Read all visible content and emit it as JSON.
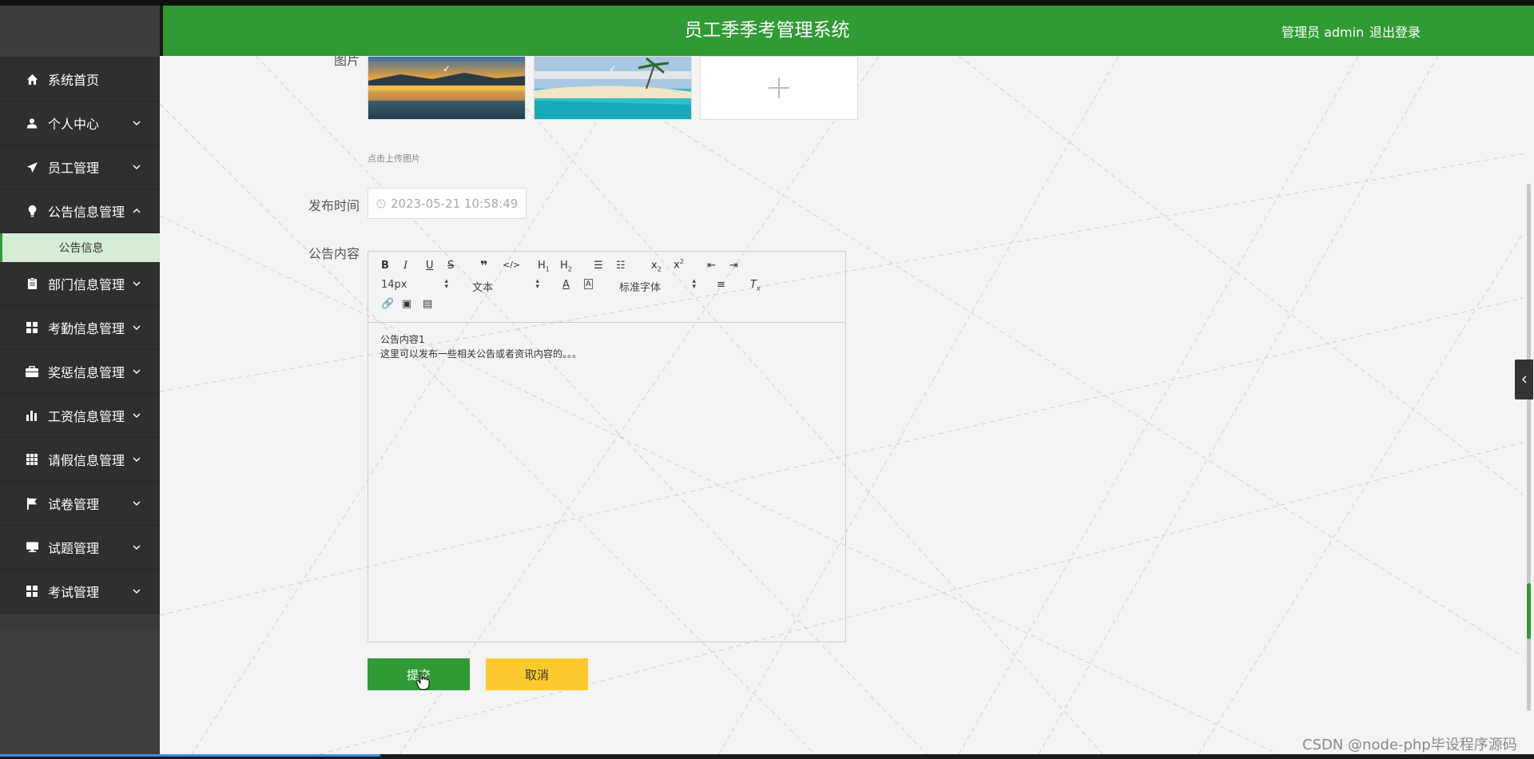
{
  "header": {
    "title": "员工季季考管理系统",
    "user": "管理员 admin",
    "logout": "退出登录"
  },
  "sidebar": {
    "items": [
      {
        "label": "系统首页",
        "icon": "home-icon",
        "chevron": false
      },
      {
        "label": "个人中心",
        "icon": "user-icon",
        "chevron": true
      },
      {
        "label": "员工管理",
        "icon": "paper-plane-icon",
        "chevron": true
      },
      {
        "label": "公告信息管理",
        "icon": "lightbulb-icon",
        "chevron": "up"
      },
      {
        "label": "部门信息管理",
        "icon": "clipboard-icon",
        "chevron": true
      },
      {
        "label": "考勤信息管理",
        "icon": "grid-icon",
        "chevron": true
      },
      {
        "label": "奖惩信息管理",
        "icon": "briefcase-icon",
        "chevron": true
      },
      {
        "label": "工资信息管理",
        "icon": "bar-chart-icon",
        "chevron": true
      },
      {
        "label": "请假信息管理",
        "icon": "table-icon",
        "chevron": true
      },
      {
        "label": "试卷管理",
        "icon": "flag-icon",
        "chevron": true
      },
      {
        "label": "试题管理",
        "icon": "monitor-icon",
        "chevron": true
      },
      {
        "label": "考试管理",
        "icon": "grid-icon",
        "chevron": true
      }
    ],
    "submenu": {
      "label": "公告信息"
    }
  },
  "form": {
    "image_label": "图片",
    "upload_hint": "点击上传图片",
    "publish_time_label": "发布时间",
    "publish_time_value": "2023-05-21 10:58:49",
    "content_label": "公告内容",
    "editor": {
      "font_size": "14px",
      "text_type": "文本",
      "font_family": "标准字体",
      "content_line1": "公告内容1",
      "content_line2": "这里可以发布一些相关公告或者资讯内容的。。。"
    },
    "submit": "提交",
    "cancel": "取消"
  },
  "watermark": "CSDN @node-php毕设程序源码",
  "colors": {
    "primary": "#309a35",
    "accent": "#fec92e",
    "sidebar": "#2f2f2f",
    "submenu_active": "#d5ecd5"
  }
}
